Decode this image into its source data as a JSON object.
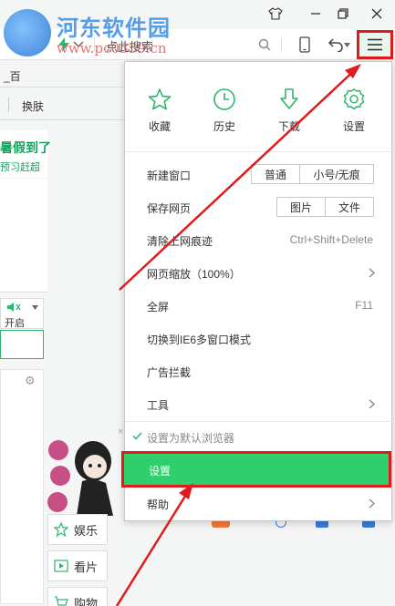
{
  "watermark": {
    "title": "河东软件园",
    "url": "www.pc0359.cn"
  },
  "addressbar": {
    "search_placeholder": "点此搜索"
  },
  "left_page": {
    "tab_text": "_百",
    "skin_label": "换肤",
    "promo_line1": "暑假到了",
    "promo_line2": "预习赶超",
    "volume_label": "开启"
  },
  "side_buttons": [
    {
      "label": "娱乐",
      "icon": "star-icon"
    },
    {
      "label": "看片",
      "icon": "play-icon"
    },
    {
      "label": "购物",
      "icon": "cart-icon"
    }
  ],
  "menu": {
    "quick": [
      {
        "label": "收藏",
        "icon": "star-outline-icon"
      },
      {
        "label": "历史",
        "icon": "clock-icon"
      },
      {
        "label": "下载",
        "icon": "download-icon"
      },
      {
        "label": "设置",
        "icon": "gear-icon"
      }
    ],
    "new_window": {
      "label": "新建窗口",
      "options": [
        "普通",
        "小号/无痕"
      ]
    },
    "save_page": {
      "label": "保存网页",
      "options": [
        "图片",
        "文件"
      ]
    },
    "clear_trace": {
      "label": "清除上网痕迹",
      "shortcut": "Ctrl+Shift+Delete"
    },
    "zoom": {
      "label": "网页缩放（100%）"
    },
    "fullscreen": {
      "label": "全屏",
      "shortcut": "F11"
    },
    "ie6_mode": {
      "label": "切换到IE6多窗口模式"
    },
    "adblock": {
      "label": "广告拦截"
    },
    "tools": {
      "label": "工具"
    },
    "default_browser": {
      "label": "设置为默认浏览器"
    },
    "settings": {
      "label": "设置"
    },
    "help": {
      "label": "帮助"
    }
  },
  "colors": {
    "accent_green": "#2db76b",
    "highlight_green": "#2fd06c",
    "annotation_red": "#e01b1b"
  }
}
